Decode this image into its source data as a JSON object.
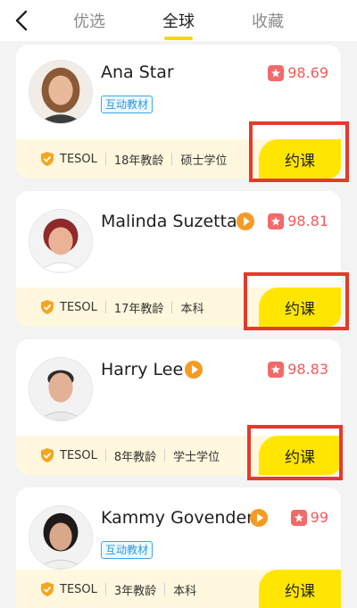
{
  "tabs": [
    {
      "label": "优选"
    },
    {
      "label": "全球"
    },
    {
      "label": "收藏"
    }
  ],
  "teachers": [
    {
      "name": "Ana Star",
      "score": "98.69",
      "tag": "互动教材",
      "cert": "TESOL",
      "years": "18年教龄",
      "degree": "硕士学位",
      "book_label": "约课",
      "has_video": false
    },
    {
      "name": "Malinda Suzetta",
      "score": "98.81",
      "tag": "",
      "cert": "TESOL",
      "years": "17年教龄",
      "degree": "本科",
      "book_label": "约课",
      "has_video": true
    },
    {
      "name": "Harry Lee",
      "score": "98.83",
      "tag": "",
      "cert": "TESOL",
      "years": "8年教龄",
      "degree": "学士学位",
      "book_label": "约课",
      "has_video": true
    },
    {
      "name": "Kammy Govender",
      "score": "99",
      "tag": "互动教材",
      "cert": "TESOL",
      "years": "3年教龄",
      "degree": "本科",
      "book_label": "约课",
      "has_video": true
    }
  ],
  "colors": {
    "accent": "#ffe600",
    "score": "#f15b5b",
    "highlight": "#e43a2b",
    "video": "#f59a23"
  }
}
